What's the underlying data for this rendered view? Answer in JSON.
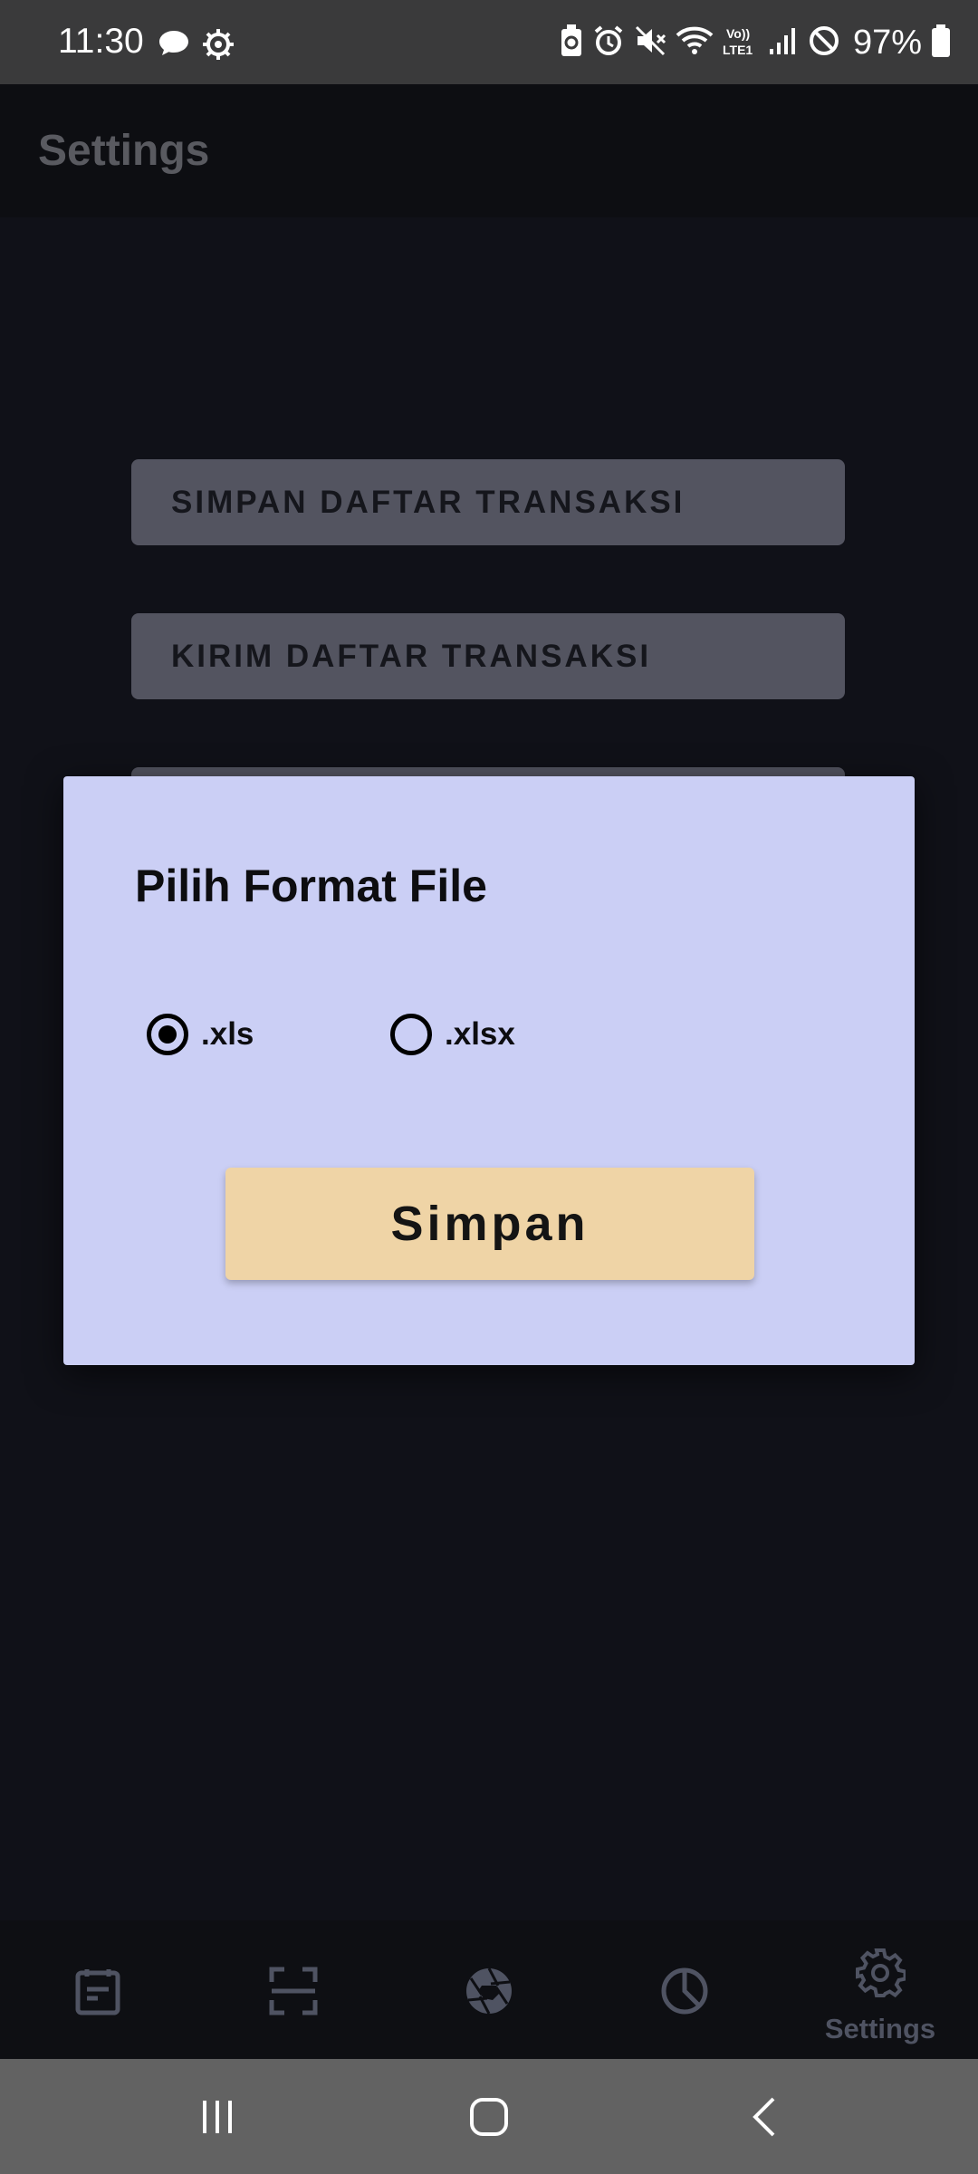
{
  "status_bar": {
    "time": "11:30",
    "battery": "97%",
    "icons": [
      "chat-bubble-icon",
      "gear-notification-icon",
      "battery-saver-icon",
      "alarm-icon",
      "mute-icon",
      "wifi-icon",
      "volte-icon",
      "signal-icon",
      "do-not-disturb-icon",
      "battery-icon"
    ]
  },
  "app_bar": {
    "title": "Settings"
  },
  "actions": [
    {
      "label": "SIMPAN DAFTAR TRANSAKSI"
    },
    {
      "label": "KIRIM DAFTAR TRANSAKSI"
    }
  ],
  "dialog": {
    "title": "Pilih Format File",
    "options": [
      {
        "label": ".xls",
        "selected": true
      },
      {
        "label": ".xlsx",
        "selected": false
      }
    ],
    "save_label": "Simpan"
  },
  "bottom_nav": {
    "items": [
      {
        "icon": "receipt-icon"
      },
      {
        "icon": "scan-icon"
      },
      {
        "icon": "aperture-icon"
      },
      {
        "icon": "pie-chart-icon"
      },
      {
        "icon": "gear-icon",
        "label": "Settings",
        "active": true
      }
    ]
  },
  "colors": {
    "background": "#101118",
    "dialog": "#cbcff5",
    "save_button": "#efd4a6",
    "action_button": "#535460"
  }
}
